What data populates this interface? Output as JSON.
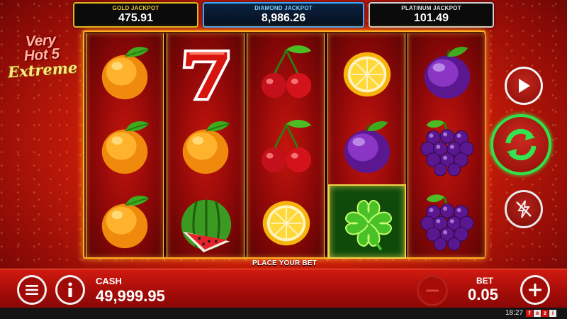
{
  "jackpots": {
    "gold": {
      "label": "GOLD JACKPOT",
      "value": "475.91"
    },
    "diamond": {
      "label": "DIAMOND JACKPOT",
      "value": "8,986.26"
    },
    "platinum": {
      "label": "PLATINUM JACKPOT",
      "value": "101.49"
    }
  },
  "logo": {
    "line1": "Very",
    "line2": "Hot 5",
    "line3": "Extreme"
  },
  "reels": [
    [
      "orange",
      "orange",
      "orange"
    ],
    [
      "seven",
      "orange",
      "watermelon"
    ],
    [
      "cherry",
      "cherry",
      "lemon"
    ],
    [
      "lemon",
      "plum",
      "clover"
    ],
    [
      "plum",
      "grapes",
      "grapes"
    ]
  ],
  "highlighted_symbol": {
    "reel": 4,
    "row": 3
  },
  "place_bet_text": "PLACE YOUR BET",
  "buttons": {
    "play": "play-icon",
    "spin": "spin-arrows-icon",
    "turbo": "turbo-off-icon",
    "menu": "menu-icon",
    "info": "info-icon",
    "minus": "minus-icon",
    "plus": "plus-icon"
  },
  "cash": {
    "label": "CASH",
    "value": "49,999.95"
  },
  "bet": {
    "label": "BET",
    "value": "0.05"
  },
  "status": {
    "time": "18:27",
    "brand": [
      "f",
      "a",
      "z",
      "i"
    ]
  },
  "colors": {
    "gold": "#e0b820",
    "diamond": "#3aa8ff",
    "platinum": "#cfcfcf",
    "spin_ring": "#30e14a",
    "bar_red": "#c4150d"
  }
}
